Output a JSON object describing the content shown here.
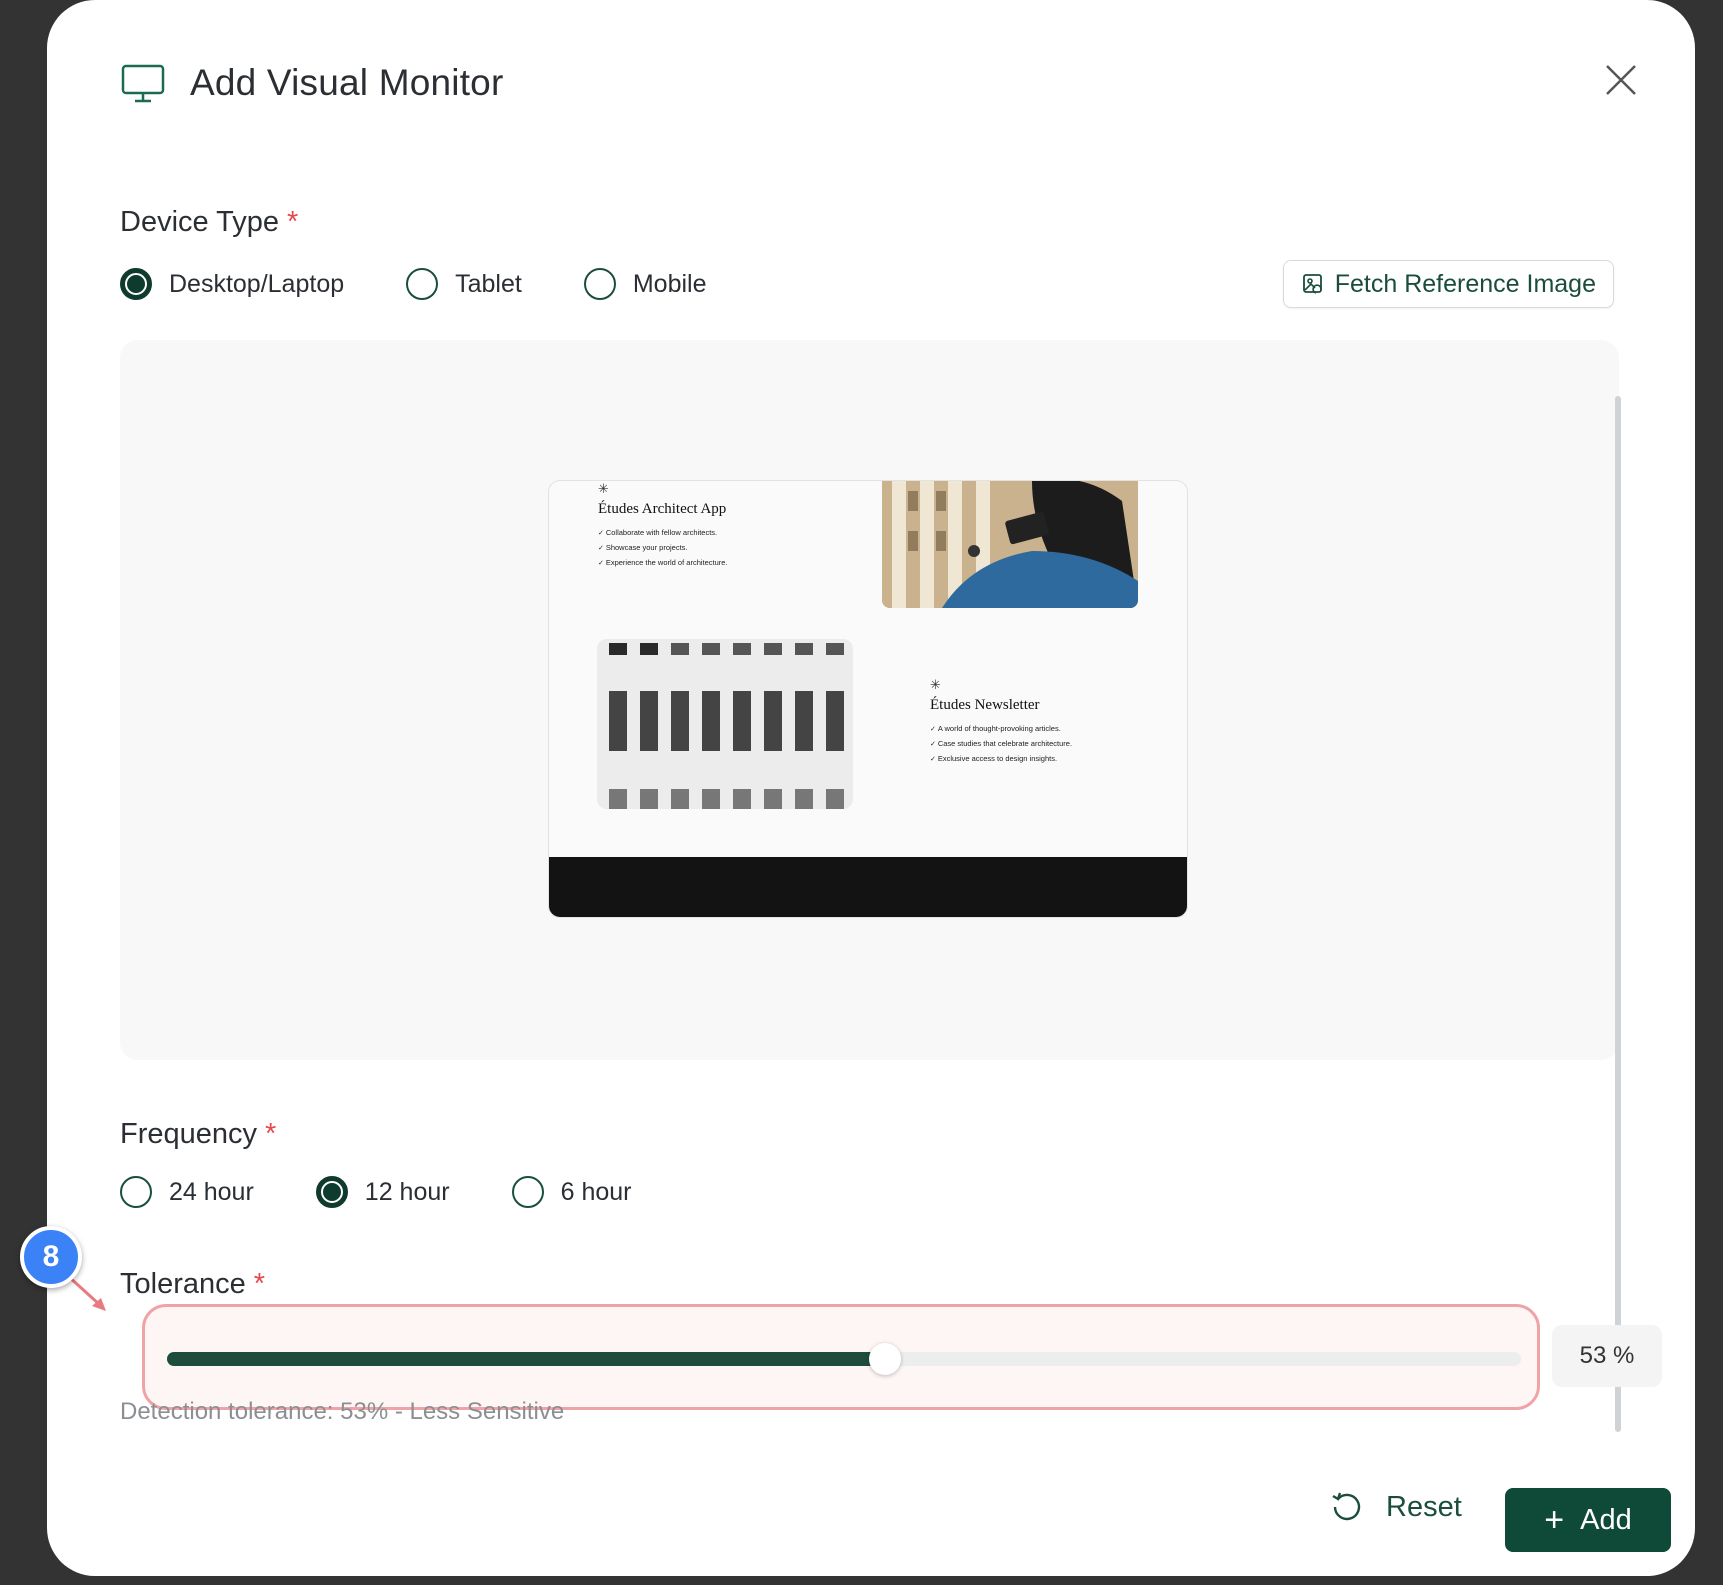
{
  "modal": {
    "title": "Add Visual Monitor",
    "icon": "monitor-icon"
  },
  "device_type": {
    "label": "Device Type",
    "required_mark": "*",
    "options": [
      {
        "label": "Desktop/Laptop",
        "selected": true
      },
      {
        "label": "Tablet",
        "selected": false
      },
      {
        "label": "Mobile",
        "selected": false
      }
    ],
    "fetch_button_label": "Fetch Reference Image"
  },
  "preview": {
    "block1": {
      "mark": "✳",
      "title": "Études Architect App",
      "items": [
        "Collaborate with fellow architects.",
        "Showcase your projects.",
        "Experience the world of architecture."
      ]
    },
    "block2": {
      "mark": "✳",
      "title": "Études Newsletter",
      "items": [
        "A world of thought-provoking articles.",
        "Case studies that celebrate architecture.",
        "Exclusive access to design insights."
      ]
    }
  },
  "frequency": {
    "label": "Frequency",
    "required_mark": "*",
    "options": [
      {
        "label": "24 hour",
        "selected": false
      },
      {
        "label": "12 hour",
        "selected": true
      },
      {
        "label": "6 hour",
        "selected": false
      }
    ]
  },
  "tolerance": {
    "label": "Tolerance",
    "required_mark": "*",
    "value": 53,
    "display": "53 %",
    "hint": "Detection tolerance: 53% - Less Sensitive"
  },
  "annotation": {
    "marker_number": "8"
  },
  "footer": {
    "reset_label": "Reset",
    "add_label": "Add"
  },
  "colors": {
    "accent": "#0f4a38",
    "required": "#e5484d",
    "annotation_blue": "#3b82f6",
    "annotation_highlight": "#f0a3a6"
  }
}
